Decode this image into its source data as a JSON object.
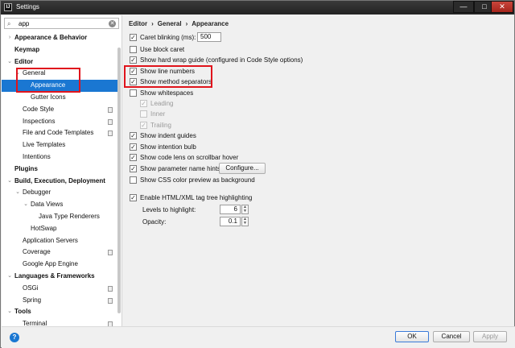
{
  "window": {
    "title": "Settings",
    "icon": "intellij-icon",
    "minimize": "—",
    "maximize": "□",
    "close": "✕"
  },
  "search": {
    "value": "app",
    "icon": "search-icon",
    "clear": "✕"
  },
  "tree": [
    {
      "label": "Appearance & Behavior",
      "bold": true,
      "arrow": "›",
      "indent": 0
    },
    {
      "label": "Keymap",
      "bold": true,
      "arrow": "",
      "indent": 0
    },
    {
      "label": "Editor",
      "bold": true,
      "arrow": "⌄",
      "indent": 0
    },
    {
      "label": "General",
      "bold": false,
      "arrow": "⌄",
      "indent": 1
    },
    {
      "label": "Appearance",
      "bold": false,
      "arrow": "",
      "indent": 2,
      "selected": true
    },
    {
      "label": "Gutter Icons",
      "bold": false,
      "arrow": "",
      "indent": 2
    },
    {
      "label": "Code Style",
      "bold": false,
      "arrow": "",
      "indent": 1,
      "copy": true
    },
    {
      "label": "Inspections",
      "bold": false,
      "arrow": "",
      "indent": 1,
      "copy": true
    },
    {
      "label": "File and Code Templates",
      "bold": false,
      "arrow": "",
      "indent": 1,
      "copy": true
    },
    {
      "label": "Live Templates",
      "bold": false,
      "arrow": "",
      "indent": 1
    },
    {
      "label": "Intentions",
      "bold": false,
      "arrow": "",
      "indent": 1
    },
    {
      "label": "Plugins",
      "bold": true,
      "arrow": "",
      "indent": 0
    },
    {
      "label": "Build, Execution, Deployment",
      "bold": true,
      "arrow": "⌄",
      "indent": 0
    },
    {
      "label": "Debugger",
      "bold": false,
      "arrow": "⌄",
      "indent": 1
    },
    {
      "label": "Data Views",
      "bold": false,
      "arrow": "⌄",
      "indent": 2
    },
    {
      "label": "Java Type Renderers",
      "bold": false,
      "arrow": "",
      "indent": 3
    },
    {
      "label": "HotSwap",
      "bold": false,
      "arrow": "",
      "indent": 2
    },
    {
      "label": "Application Servers",
      "bold": false,
      "arrow": "",
      "indent": 1
    },
    {
      "label": "Coverage",
      "bold": false,
      "arrow": "",
      "indent": 1,
      "copy": true
    },
    {
      "label": "Google App Engine",
      "bold": false,
      "arrow": "",
      "indent": 1
    },
    {
      "label": "Languages & Frameworks",
      "bold": true,
      "arrow": "⌄",
      "indent": 0
    },
    {
      "label": "OSGi",
      "bold": false,
      "arrow": "",
      "indent": 1,
      "copy": true
    },
    {
      "label": "Spring",
      "bold": false,
      "arrow": "",
      "indent": 1,
      "copy": true
    },
    {
      "label": "Tools",
      "bold": true,
      "arrow": "⌄",
      "indent": 0
    },
    {
      "label": "Terminal",
      "bold": false,
      "arrow": "",
      "indent": 1,
      "copy": true
    }
  ],
  "breadcrumb": [
    "Editor",
    "›",
    "General",
    "›",
    "Appearance"
  ],
  "options": {
    "caret_blinking": {
      "label": "Caret blinking (ms):",
      "checked": true,
      "value": "500"
    },
    "block_caret": {
      "label": "Use block caret",
      "checked": false
    },
    "hard_wrap": {
      "label": "Show hard wrap guide (configured in Code Style options)",
      "checked": true
    },
    "line_numbers": {
      "label": "Show line numbers",
      "checked": true
    },
    "method_separators": {
      "label": "Show method separators",
      "checked": true
    },
    "whitespaces": {
      "label": "Show whitespaces",
      "checked": false
    },
    "leading": {
      "label": "Leading",
      "checked": true
    },
    "inner": {
      "label": "Inner",
      "checked": false
    },
    "trailing": {
      "label": "Trailing",
      "checked": true
    },
    "indent_guides": {
      "label": "Show indent guides",
      "checked": true
    },
    "intention_bulb": {
      "label": "Show intention bulb",
      "checked": true
    },
    "code_lens": {
      "label": "Show code lens on scrollbar hover",
      "checked": true
    },
    "param_hints": {
      "label": "Show parameter name hints",
      "checked": true,
      "button": "Configure..."
    },
    "css_color": {
      "label": "Show CSS color preview as background",
      "checked": false
    },
    "html_xml": {
      "label": "Enable HTML/XML tag tree highlighting",
      "checked": true
    },
    "levels": {
      "label": "Levels to highlight:",
      "value": "6"
    },
    "opacity": {
      "label": "Opacity:",
      "value": "0.1"
    }
  },
  "check_mark": "✓",
  "footer": {
    "help": "?",
    "ok": "OK",
    "cancel": "Cancel",
    "apply": "Apply"
  }
}
